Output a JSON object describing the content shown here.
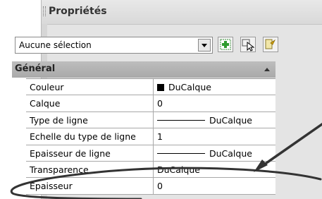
{
  "panel": {
    "title": "Propriétés"
  },
  "selection": {
    "value": "Aucune sélection"
  },
  "toolbar": {
    "icons": [
      "toggle-pickadd-icon",
      "select-objects-icon",
      "quick-select-icon"
    ]
  },
  "section": {
    "label": "Général"
  },
  "properties": [
    {
      "name": "Couleur",
      "value": "DuCalque"
    },
    {
      "name": "Calque",
      "value": "0"
    },
    {
      "name": "Type de ligne",
      "value": "DuCalque"
    },
    {
      "name": "Echelle du type de ligne",
      "value": "1"
    },
    {
      "name": "Epaisseur de ligne",
      "value": "DuCalque"
    },
    {
      "name": "Transparence",
      "value": "DuCalque"
    },
    {
      "name": "Epaisseur",
      "value": "0"
    }
  ],
  "colors": {
    "annotation": "#333333",
    "swatch": "#000000"
  }
}
